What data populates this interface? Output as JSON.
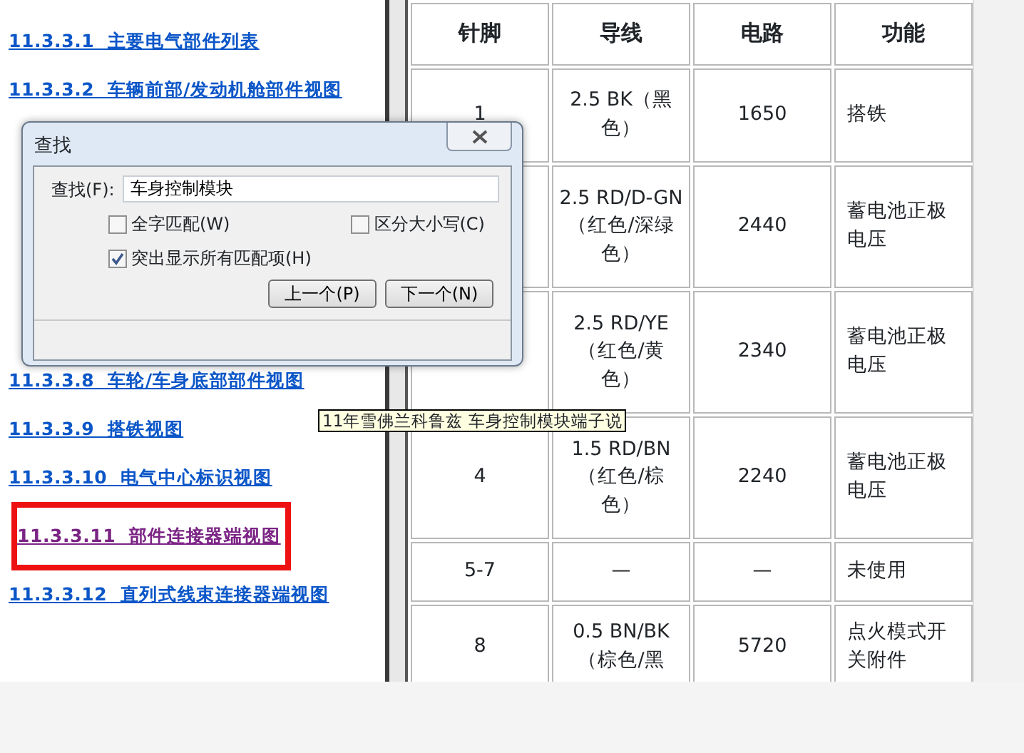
{
  "links": [
    {
      "number": "11.3.3.1",
      "title": "主要电气部件列表",
      "visited": false,
      "highlighted": false
    },
    {
      "number": "11.3.3.2",
      "title": "车辆前部/发动机舱部件视图",
      "visited": false,
      "highlighted": false
    },
    {
      "number": "11.3.3.8",
      "title": "车轮/车身底部部件视图",
      "visited": false,
      "highlighted": false
    },
    {
      "number": "11.3.3.9",
      "title": "搭铁视图",
      "visited": false,
      "highlighted": false
    },
    {
      "number": "11.3.3.10",
      "title": "电气中心标识视图",
      "visited": false,
      "highlighted": false
    },
    {
      "number": "11.3.3.11",
      "title": "部件连接器端视图",
      "visited": true,
      "highlighted": true
    },
    {
      "number": "11.3.3.12",
      "title": "直列式线束连接器端视图",
      "visited": false,
      "highlighted": false
    }
  ],
  "find_dialog": {
    "title": "查找",
    "field_label": "查找(F):",
    "value": "车身控制模块",
    "options": [
      {
        "label": "全字匹配(W)",
        "checked": false
      },
      {
        "label": "区分大小写(C)",
        "checked": false
      },
      {
        "label": "突出显示所有匹配项(H)",
        "checked": true
      }
    ],
    "buttons": [
      "上一个(P)",
      "下一个(N)"
    ]
  },
  "table": {
    "columns": [
      "针脚",
      "导线",
      "电路",
      "功能"
    ],
    "rows": [
      {
        "pin": "1",
        "wire": "2.5 BK（黑色）",
        "circuit": "1650",
        "function": "搭铁"
      },
      {
        "wire": "2.5 RD/D-GN（红色/深绿色）",
        "circuit": "2440",
        "function": "蓄电池正极电压"
      },
      {
        "wire": "2.5 RD/YE（红色/黄色）",
        "circuit": "2340",
        "function": "蓄电池正极电压"
      },
      {
        "pin": "4",
        "wire": "1.5 RD/BN（红色/棕色）",
        "circuit": "2240",
        "function": "蓄电池正极电压"
      },
      {
        "pin": "5-7",
        "wire": "—",
        "circuit": "—",
        "function": "未使用"
      },
      {
        "pin": "8",
        "wire": "0.5 BN/BK（棕色/黑",
        "circuit": "5720",
        "function": "点火模式开关附件"
      }
    ]
  },
  "tooltip": "11年雪佛兰科鲁兹 车身控制模块端子说"
}
